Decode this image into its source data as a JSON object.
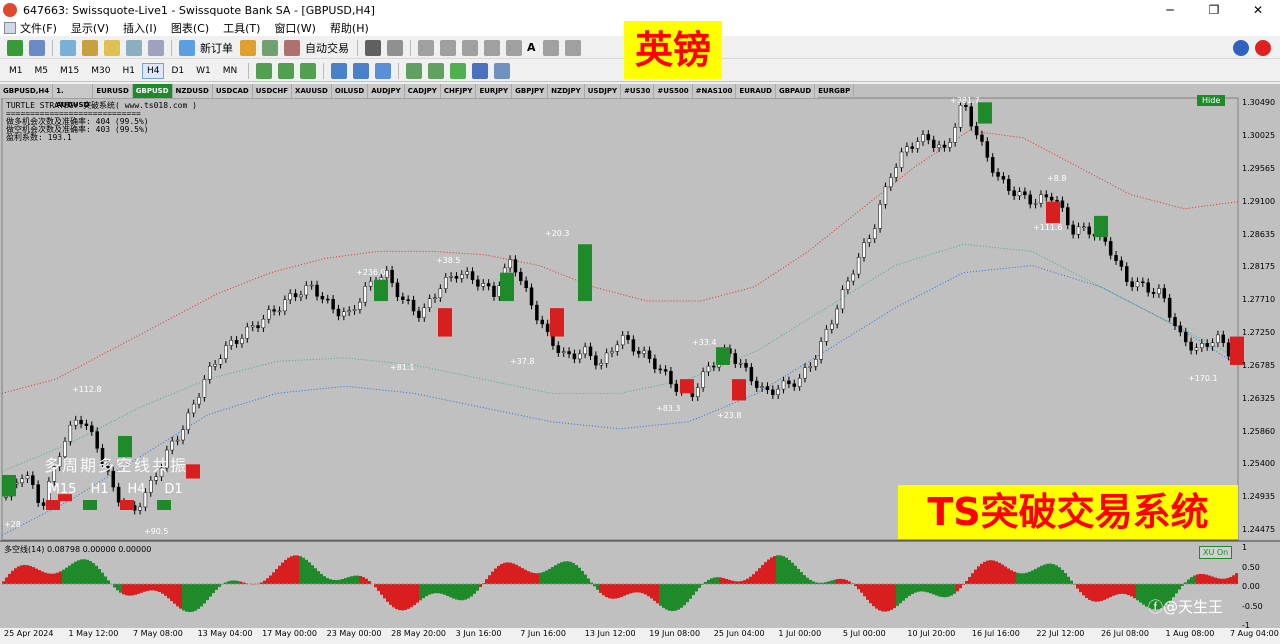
{
  "window": {
    "title": "647663: Swissquote-Live1 - Swissquote Bank SA - [GBPUSD,H4]",
    "minimize": "─",
    "maximize": "❐",
    "close": "✕"
  },
  "menu": [
    "文件(F)",
    "显示(V)",
    "插入(I)",
    "图表(C)",
    "工具(T)",
    "窗口(W)",
    "帮助(H)"
  ],
  "toolbar": {
    "new_order": "新订单",
    "auto_trade": "自动交易",
    "draw_text": "A"
  },
  "timeframes": [
    "M1",
    "M5",
    "M15",
    "M30",
    "H1",
    "H4",
    "D1",
    "W1",
    "MN"
  ],
  "active_timeframe": "H4",
  "overlay_top": "英镑",
  "overlay_bottom": "TS突破交易系统",
  "symbols": [
    "GBPUSD,H4",
    "1. AUDUSD",
    "EURUSD",
    "GBPUSD",
    "NZDUSD",
    "USDCAD",
    "USDCHF",
    "XAUUSD",
    "OILUSD",
    "AUDJPY",
    "CADJPY",
    "CHFJPY",
    "EURJPY",
    "GBPJPY",
    "NZDJPY",
    "USDJPY",
    "#US30",
    "#US500",
    "#NAS100",
    "EURAUD",
    "GBPAUD",
    "EURGBP"
  ],
  "active_symbol": "GBPUSD",
  "info": {
    "line1": "TURTLE STRATEGY 突破系统(  www.ts018.com  )",
    "line2": "============================",
    "line3": "做多机会次数及准确率: 404 (99.5%)",
    "line4": "做空机会次数及准确率: 403 (99.5%)",
    "line5": "盈利系数: 193.1"
  },
  "hide_label": "Hide",
  "xu_on_label": "XU On",
  "indicator_label": "多空线(14) 0.08798 0.00000 0.00000",
  "watermark_cn": "多周期多空线共振",
  "tf_panel": [
    "M15",
    "H1",
    "H4",
    "D1"
  ],
  "watermark_br": "ⓕ@天生王",
  "colors": {
    "bull": "#1e8a2a",
    "bear": "#d81e1e",
    "chart_bg": "#c0c0c0",
    "upper_band": "#e03030",
    "lower_band": "#3070e0",
    "mid_band": "#40b080"
  },
  "chart_data": {
    "type": "line",
    "title": "GBPUSD,H4",
    "y_ticks": [
      "1.30490",
      "1.30025",
      "1.29565",
      "1.29100",
      "1.28635",
      "1.28175",
      "1.27710",
      "1.27250",
      "1.26785",
      "1.26325",
      "1.25860",
      "1.25400",
      "1.24935",
      "1.24475"
    ],
    "x_ticks": [
      "25 Apr 2024",
      "1 May 12:00",
      "7 May 08:00",
      "13 May 04:00",
      "17 May 00:00",
      "23 May 00:00",
      "28 May 20:00",
      "3 Jun 16:00",
      "7 Jun 16:00",
      "13 Jun 12:00",
      "19 Jun 08:00",
      "25 Jun 04:00",
      "1 Jul 00:00",
      "5 Jul 00:00",
      "10 Jul 20:00",
      "16 Jul 16:00",
      "22 Jul 12:00",
      "26 Jul 08:00",
      "1 Aug 08:00",
      "7 Aug 04:00"
    ],
    "indicator_ticks": [
      "1",
      "0.50",
      "0.00",
      "-0.50",
      "-1"
    ],
    "annotations": [
      "+28",
      "+112.8",
      "+90.5",
      "+236.0",
      "+81.1",
      "+38.5",
      "+37.8",
      "+20.3",
      "+83.3",
      "+33.4",
      "+23.8",
      "+381.7",
      "+8.8",
      "+111.6",
      "+170.1"
    ],
    "close_series": [
      1.2495,
      1.253,
      1.248,
      1.256,
      1.261,
      1.257,
      1.25,
      1.247,
      1.251,
      1.256,
      1.26,
      1.266,
      1.27,
      1.272,
      1.274,
      1.276,
      1.278,
      1.279,
      1.276,
      1.275,
      1.279,
      1.281,
      1.277,
      1.275,
      1.279,
      1.281,
      1.28,
      1.278,
      1.283,
      1.277,
      1.272,
      1.269,
      1.27,
      1.268,
      1.272,
      1.27,
      1.268,
      1.265,
      1.264,
      1.268,
      1.27,
      1.267,
      1.264,
      1.265,
      1.266,
      1.27,
      1.276,
      1.282,
      1.287,
      1.295,
      1.299,
      1.3,
      1.298,
      1.305,
      1.299,
      1.294,
      1.292,
      1.291,
      1.292,
      1.287,
      1.287,
      1.285,
      1.28,
      1.279,
      1.278,
      1.272,
      1.27,
      1.272,
      1.269
    ],
    "upper_band": [
      1.264,
      1.266,
      1.27,
      1.274,
      1.278,
      1.281,
      1.283,
      1.284,
      1.284,
      1.2835,
      1.282,
      1.279,
      1.277,
      1.277,
      1.279,
      1.284,
      1.29,
      1.296,
      1.301,
      1.3,
      1.296,
      1.292,
      1.29,
      1.291
    ],
    "mid_band": [
      1.253,
      1.257,
      1.262,
      1.266,
      1.2685,
      1.269,
      1.268,
      1.266,
      1.264,
      1.264,
      1.266,
      1.27,
      1.276,
      1.282,
      1.285,
      1.284,
      1.279,
      1.274,
      1.269
    ],
    "lower_band": [
      1.244,
      1.249,
      1.255,
      1.261,
      1.264,
      1.265,
      1.264,
      1.262,
      1.26,
      1.259,
      1.26,
      1.264,
      1.27,
      1.276,
      1.281,
      1.282,
      1.279,
      1.274,
      1.268
    ]
  }
}
